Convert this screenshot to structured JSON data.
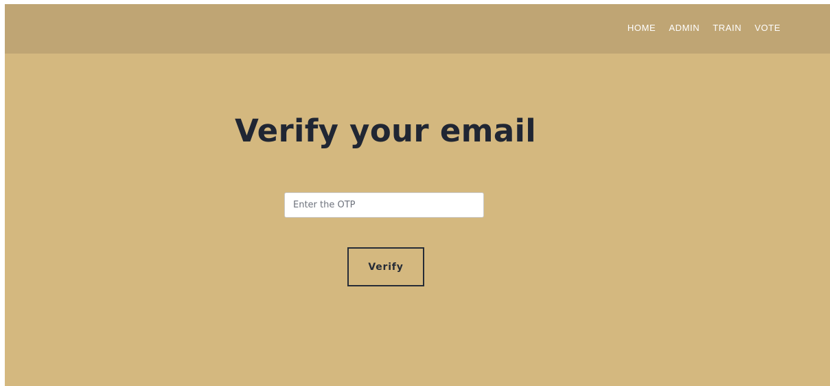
{
  "nav": {
    "items": [
      {
        "label": "HOME"
      },
      {
        "label": "ADMIN"
      },
      {
        "label": "TRAIN"
      },
      {
        "label": "VOTE"
      }
    ]
  },
  "main": {
    "title": "Verify your email",
    "otp_input": {
      "placeholder": "Enter the OTP",
      "value": ""
    },
    "verify_button": {
      "label": "Verify"
    }
  },
  "colors": {
    "background": "#d4b87f",
    "navbar": "#bfa574",
    "text_dark": "#202633",
    "nav_text": "#ffffff"
  }
}
